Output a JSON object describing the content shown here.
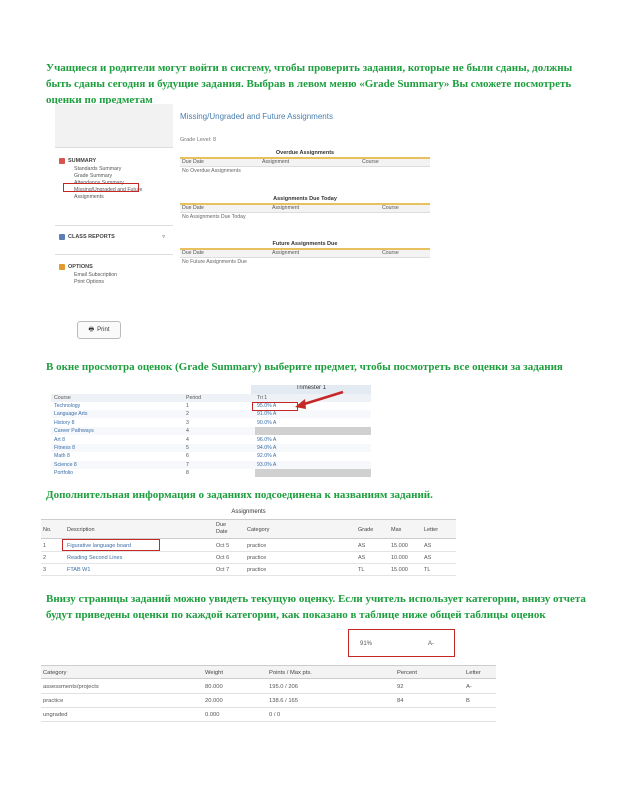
{
  "paragraphs": {
    "p1": "Учащиеся и родители могут войти в систему, чтобы проверить задания, которые не были сданы, должны быть сданы сегодня и будущие задания. Выбрав в левом меню «Grade Summary» Вы сможете посмотреть оценки по предметам",
    "p2": "В окне просмотра оценок (Grade Summary) выберите предмет, чтобы посмотреть все оценки за задания",
    "p3": "Дополнительная информация о заданиях подсоединена к названиям заданий.",
    "p4": "Внизу страницы заданий можно увидеть текущую оценку. Если учитель использует категории, внизу отчета будут приведены оценки по каждой категории, как показано в таблице ниже общей таблицы оценок"
  },
  "screen1": {
    "title": "Missing/Ungraded and Future Assignments",
    "subtitle": "Grade Level: 8",
    "sections": [
      {
        "heading": "SUMMARY",
        "color": "#d9534f",
        "items": [
          "Standards Summary",
          "Grade Summary",
          "Attendance Summary",
          "Missing/Ungraded and Future Assignments"
        ]
      },
      {
        "heading": "CLASS REPORTS",
        "color": "#5b7fb5",
        "items": []
      },
      {
        "heading": "OPTIONS",
        "color": "#e09a2e",
        "items": [
          "Email Subscription",
          "Print Options"
        ]
      }
    ],
    "print_label": "Print",
    "blocks": [
      {
        "title": "Overdue Assignments",
        "cols": [
          "Due Date",
          "Assignment",
          "Course"
        ],
        "row": "No Overdue Assignments"
      },
      {
        "title": "Assignments Due Today",
        "cols": [
          "Due Date",
          "Assignment",
          "Course"
        ],
        "row": "No Assignments Due Today"
      },
      {
        "title": "Future Assignments Due",
        "cols": [
          "Due Date",
          "Assignment",
          "Course"
        ],
        "row": "No Future Assignments Due"
      }
    ]
  },
  "screen2": {
    "header": "Trimester 1",
    "cols": [
      "Course",
      "Period",
      "Tri 1"
    ],
    "rows": [
      {
        "course": "Technology",
        "period": "1",
        "grade": "95.0% A"
      },
      {
        "course": "Language Arts",
        "period": "2",
        "grade": "91.0% A"
      },
      {
        "course": "History 8",
        "period": "3",
        "grade": "90.0% A"
      },
      {
        "course": "Career Pathways",
        "period": "4",
        "grade": ""
      },
      {
        "course": "Art 8",
        "period": "4",
        "grade": "96.0% A"
      },
      {
        "course": "Fitness 8",
        "period": "5",
        "grade": "94.0% A"
      },
      {
        "course": "Math 8",
        "period": "6",
        "grade": "92.0% A"
      },
      {
        "course": "Science 8",
        "period": "7",
        "grade": "93.0% A"
      },
      {
        "course": "Portfolio",
        "period": "8",
        "grade": ""
      }
    ]
  },
  "screen3": {
    "caption": "Assignments",
    "cols": [
      "No.",
      "Description",
      "Due Date",
      "Category",
      "Grade",
      "Max",
      "Letter"
    ],
    "rows": [
      {
        "no": "1",
        "desc": "Figurative language board",
        "due": "Oct 5",
        "cat": "practice",
        "grade": "AS",
        "max": "15.000",
        "letter": "AS"
      },
      {
        "no": "2",
        "desc": "Reading Second Lines",
        "due": "Oct 6",
        "cat": "practice",
        "grade": "AS",
        "max": "10.000",
        "letter": "AS"
      },
      {
        "no": "3",
        "desc": "FTAB W1",
        "due": "Oct 7",
        "cat": "practice",
        "grade": "TL",
        "max": "15.000",
        "letter": "TL"
      }
    ]
  },
  "screen4": {
    "summary_pct": "91%",
    "summary_letter": "A-",
    "cols": [
      "Category",
      "Weight",
      "Points / Max pts.",
      "Percent",
      "Letter"
    ],
    "rows": [
      {
        "cat": "assessments/projects",
        "weight": "80.000",
        "points": "195.0 / 206",
        "pct": "92",
        "letter": "A-"
      },
      {
        "cat": "practice",
        "weight": "20.000",
        "points": "138.6 / 165",
        "pct": "84",
        "letter": "B"
      },
      {
        "cat": "ungraded",
        "weight": "0.000",
        "points": "0 / 0",
        "pct": "",
        "letter": ""
      }
    ]
  }
}
